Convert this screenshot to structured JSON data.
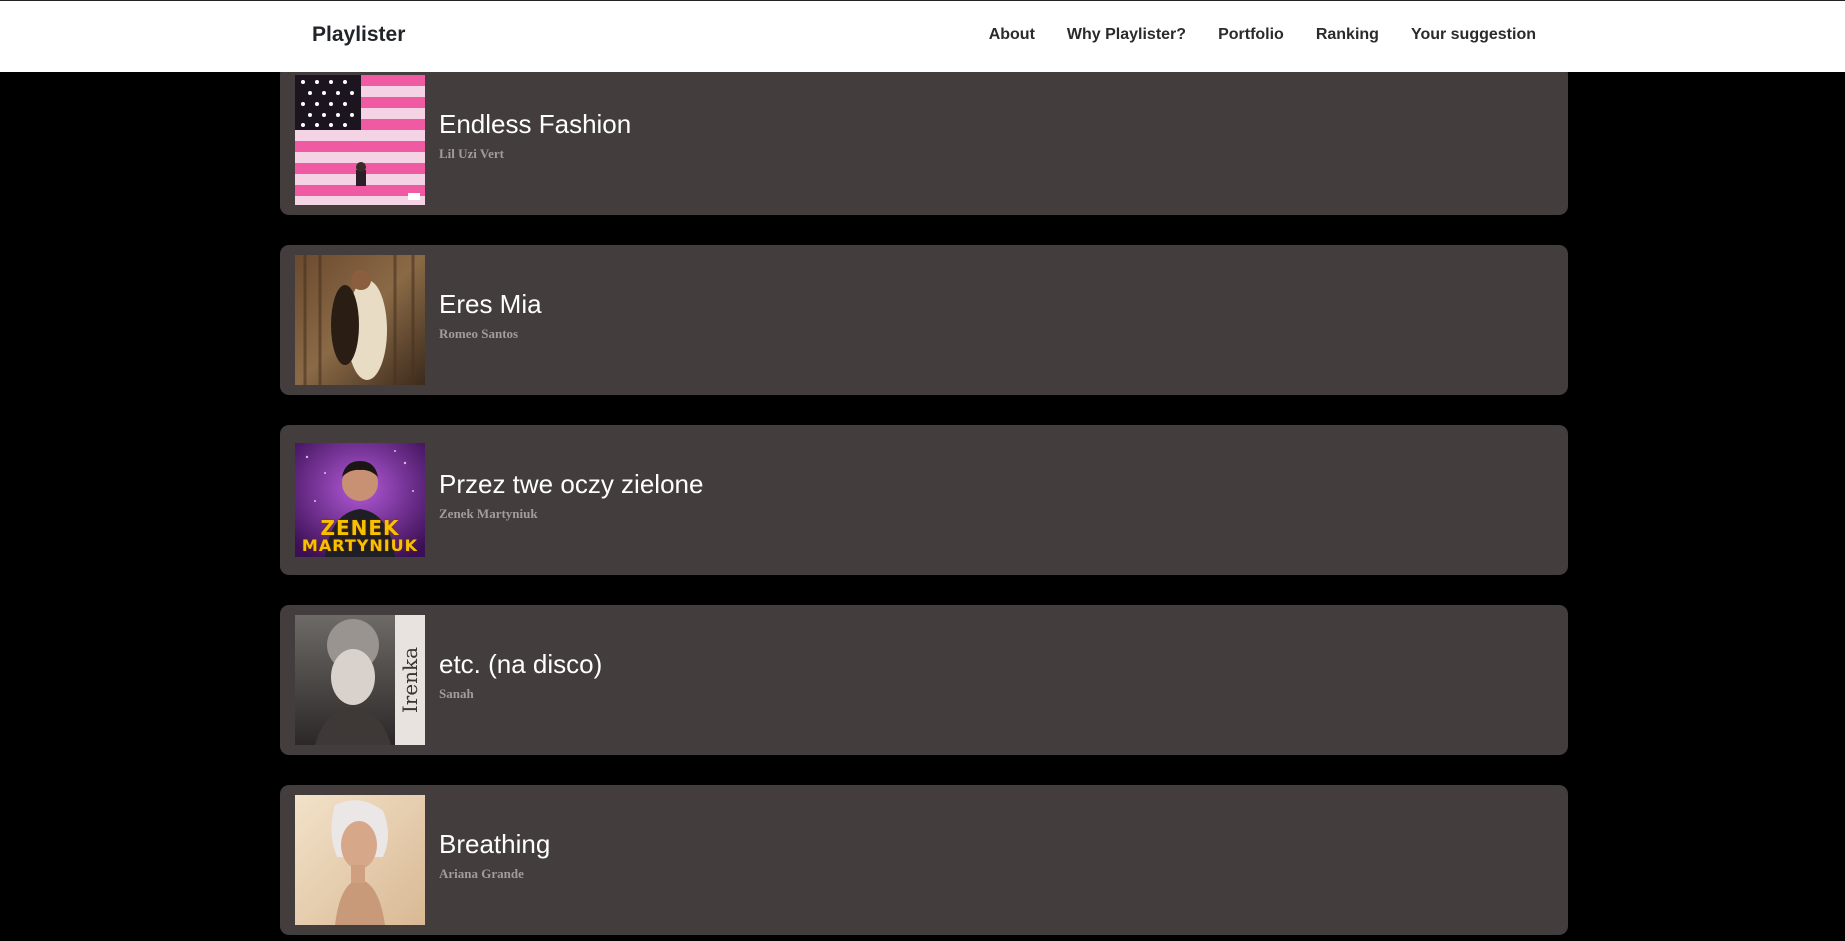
{
  "navbar": {
    "brand": "Playlister",
    "links": [
      {
        "label": "About"
      },
      {
        "label": "Why Playlister?"
      },
      {
        "label": "Portfolio"
      },
      {
        "label": "Ranking"
      },
      {
        "label": "Your suggestion"
      }
    ]
  },
  "songs": [
    {
      "title": "Endless Fashion",
      "artist": "Lil Uzi Vert",
      "cover": "pink-american-flag-cover"
    },
    {
      "title": "Eres Mia",
      "artist": "Romeo Santos",
      "cover": "romeo-santos-cover"
    },
    {
      "title": "Przez twe oczy zielone",
      "artist": "Zenek Martyniuk",
      "cover": "zenek-martyniuk-cover",
      "cover_text": [
        "ZENEK",
        "MARTYNIUK"
      ]
    },
    {
      "title": "etc. (na disco)",
      "artist": "Sanah",
      "cover": "irenka-cover",
      "cover_text": [
        "Irenka"
      ]
    },
    {
      "title": "Breathing",
      "artist": "Ariana Grande",
      "cover": "ariana-grande-cover"
    }
  ],
  "colors": {
    "page_bg": "#000000",
    "card_bg": "#433d3e",
    "title": "#ffffff",
    "artist": "#a39b9c"
  }
}
